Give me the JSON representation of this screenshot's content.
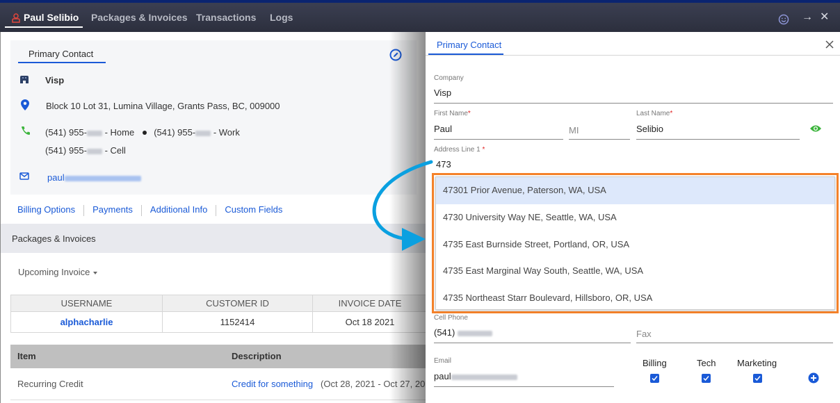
{
  "topbar": {
    "tabs": [
      {
        "label": "Paul Selibio",
        "active": true,
        "icon": "user-icon"
      },
      {
        "label": "Packages & Invoices",
        "active": false
      },
      {
        "label": "Transactions",
        "active": false
      },
      {
        "label": "Logs",
        "active": false
      }
    ],
    "icons": [
      "smile-icon",
      "arrow-right-icon",
      "close-icon"
    ],
    "arrow_glyph": "→",
    "close_glyph": "✕"
  },
  "contact_card": {
    "title": "Primary Contact",
    "company": "Visp",
    "address": "Block 10 Lot 31, Lumina Village, Grants Pass, BC, 009000",
    "phones": {
      "home_prefix": "(541) 955-",
      "home_suffix": " - Home",
      "work_prefix": "(541) 955-",
      "work_suffix": " - Work",
      "cell_prefix": "(541) 955-",
      "cell_suffix": " - Cell"
    },
    "email_prefix": "paul"
  },
  "links": [
    "Billing Options",
    "Payments",
    "Additional Info",
    "Custom Fields"
  ],
  "packages": {
    "section_title": "Packages & Invoices",
    "upcoming_label": "Upcoming Invoice",
    "table": {
      "headers": [
        "USERNAME",
        "CUSTOMER ID",
        "INVOICE DATE"
      ],
      "rows": [
        [
          "alphacharlie",
          "1152414",
          "Oct 18 2021"
        ]
      ]
    },
    "items": {
      "headers": [
        "Item",
        "Description"
      ],
      "rows": [
        {
          "item": "Recurring Credit",
          "description_link": "Credit for something",
          "period": "(Oct 28, 2021 - Oct 27, 20"
        }
      ]
    }
  },
  "panel": {
    "tab": "Primary Contact",
    "fields": {
      "company": {
        "label": "Company",
        "value": "Visp"
      },
      "first_name": {
        "label": "First Name",
        "value": "Paul",
        "required": "*"
      },
      "mi": {
        "placeholder": "MI"
      },
      "last_name": {
        "label": "Last Name",
        "value": "Selibio",
        "required": "*"
      },
      "address1": {
        "label": "Address Line 1",
        "value": "473",
        "required": "*"
      },
      "cell_phone": {
        "label": "Cell Phone",
        "value_prefix": "(541) "
      },
      "fax": {
        "placeholder": "Fax"
      },
      "email": {
        "label": "Email",
        "value_prefix": "paul"
      }
    },
    "suggestions": [
      "47301 Prior Avenue, Paterson, WA, USA",
      "4730 University Way NE, Seattle, WA, USA",
      "4735 East Burnside Street, Portland, OR, USA",
      "4735 East Marginal Way South, Seattle, WA, USA",
      "4735 Northeast Starr Boulevard, Hillsboro, OR, USA"
    ],
    "highlighted_suggestion": 0,
    "contact_types": [
      {
        "label": "Billing",
        "checked": true
      },
      {
        "label": "Tech",
        "checked": true
      },
      {
        "label": "Marketing",
        "checked": true
      }
    ]
  },
  "colors": {
    "accent": "#1a5ad7",
    "highlight_border": "#f5822a",
    "annotation_arrow": "#0aa0e0",
    "eye_icon": "#3cb43c",
    "topbar": "#33364a"
  }
}
